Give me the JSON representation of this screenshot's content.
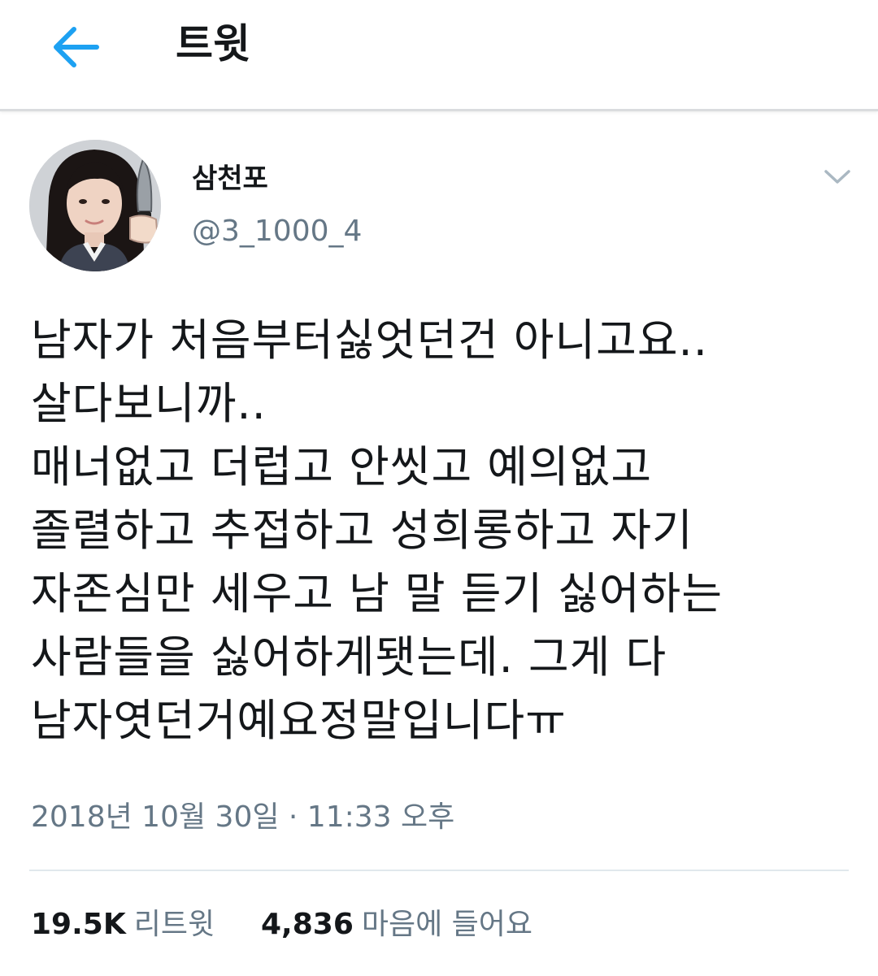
{
  "header": {
    "back_icon": "arrow-left-icon",
    "title": "트윗",
    "accent_color": "#1da1f2"
  },
  "tweet": {
    "author": {
      "display_name": "삼천포",
      "handle": "@3_1000_4",
      "avatar_icon": "avatar-photo"
    },
    "menu_icon": "chevron-down-icon",
    "lines": [
      "남자가 처음부터싫엇던건 아니고요..",
      "살다보니까..",
      "매너없고 더럽고 안씻고 예의없고",
      "졸렬하고 추접하고 성희롱하고 자기",
      "자존심만 세우고 남 말 듣기 싫어하는",
      "사람들을 싫어하게됏는데. 그게 다",
      "남자엿던거예요정말입니다ㅠ"
    ],
    "timestamp": "2018년 10월 30일 · 11:33 오후"
  },
  "stats": {
    "retweets_count": "19.5K",
    "retweets_label": "리트윗",
    "likes_count": "4,836",
    "likes_label": "마음에 들어요"
  }
}
